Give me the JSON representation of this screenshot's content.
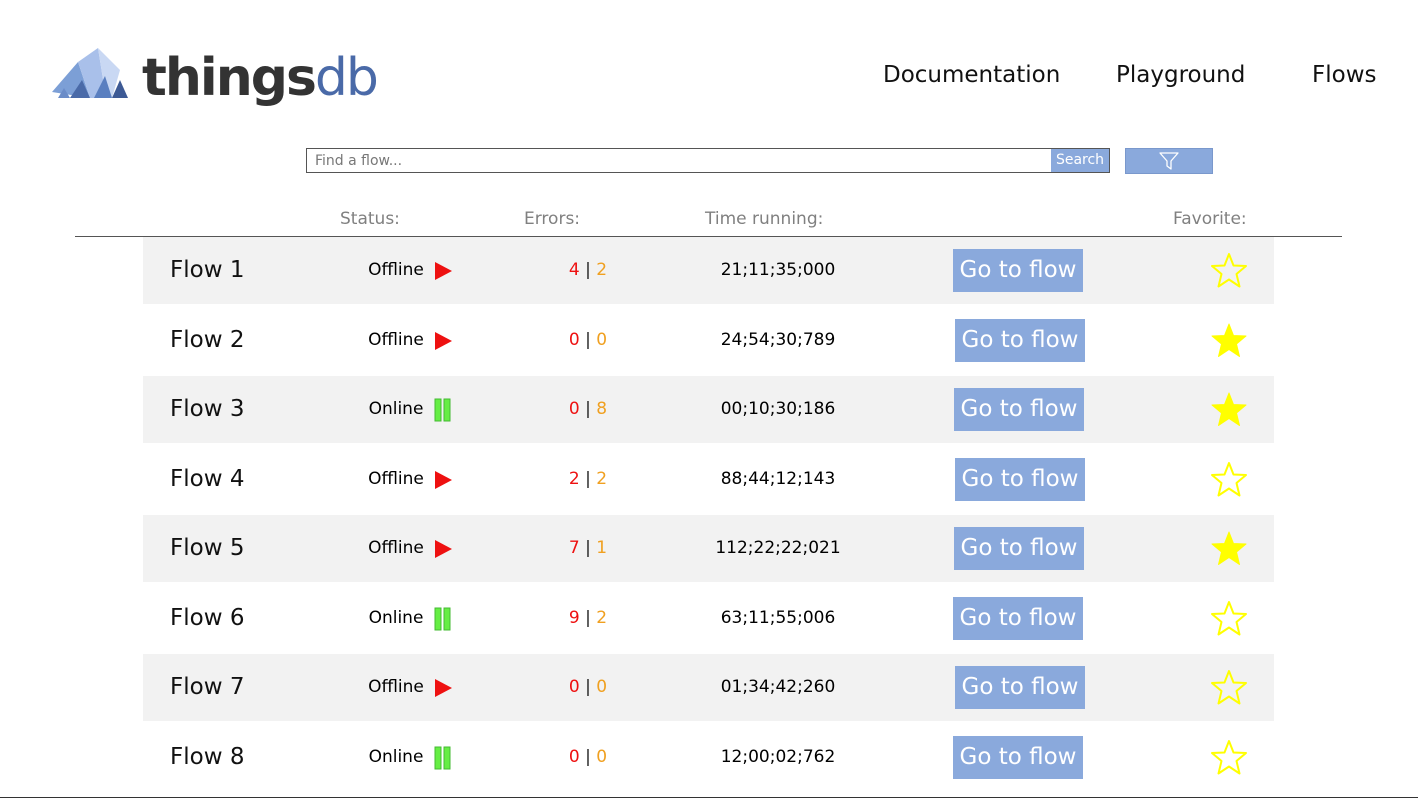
{
  "logo": {
    "text_main": "things",
    "text_accent": "db"
  },
  "nav": {
    "items": [
      "Documentation",
      "Playground",
      "Flows"
    ]
  },
  "search": {
    "placeholder": "Find a flow...",
    "button_label": "Search",
    "filter_icon": "filter-icon"
  },
  "columns": {
    "status": "Status:",
    "errors": "Errors:",
    "time": "Time running:",
    "favorite": "Favorite:"
  },
  "colors": {
    "accent": "#8aa9dc",
    "error": "#ee1111",
    "warning": "#f0a020",
    "play": "#ee1111",
    "pause": "#66ee44",
    "star": "#ffff00"
  },
  "flows": [
    {
      "name": "Flow 1",
      "status": "Offline",
      "status_icon": "play-icon",
      "errors": "4",
      "separator": "|",
      "warnings": "2",
      "time": "21;11;35;000",
      "button": "Go to flow",
      "favorite": false
    },
    {
      "name": "Flow 2",
      "status": "Offline",
      "status_icon": "play-icon",
      "errors": "0",
      "separator": "|",
      "warnings": "0",
      "time": "24;54;30;789",
      "button": "Go to flow",
      "favorite": true
    },
    {
      "name": "Flow 3",
      "status": "Online",
      "status_icon": "pause-icon",
      "errors": "0",
      "separator": "|",
      "warnings": "8",
      "time": "00;10;30;186",
      "button": "Go to flow",
      "favorite": true
    },
    {
      "name": "Flow 4",
      "status": "Offline",
      "status_icon": "play-icon",
      "errors": "2",
      "separator": "|",
      "warnings": "2",
      "time": "88;44;12;143",
      "button": "Go to flow",
      "favorite": false
    },
    {
      "name": "Flow 5",
      "status": "Offline",
      "status_icon": "play-icon",
      "errors": "7",
      "separator": "|",
      "warnings": "1",
      "time": "112;22;22;021",
      "button": "Go to flow",
      "favorite": true
    },
    {
      "name": "Flow 6",
      "status": "Online",
      "status_icon": "pause-icon",
      "errors": "9",
      "separator": "|",
      "warnings": "2",
      "time": "63;11;55;006",
      "button": "Go to flow",
      "favorite": false
    },
    {
      "name": "Flow 7",
      "status": "Offline",
      "status_icon": "play-icon",
      "errors": "0",
      "separator": "|",
      "warnings": "0",
      "time": "01;34;42;260",
      "button": "Go to flow",
      "favorite": false
    },
    {
      "name": "Flow 8",
      "status": "Online",
      "status_icon": "pause-icon",
      "errors": "0",
      "separator": "|",
      "warnings": "0",
      "time": "12;00;02;762",
      "button": "Go to flow",
      "favorite": false
    }
  ]
}
